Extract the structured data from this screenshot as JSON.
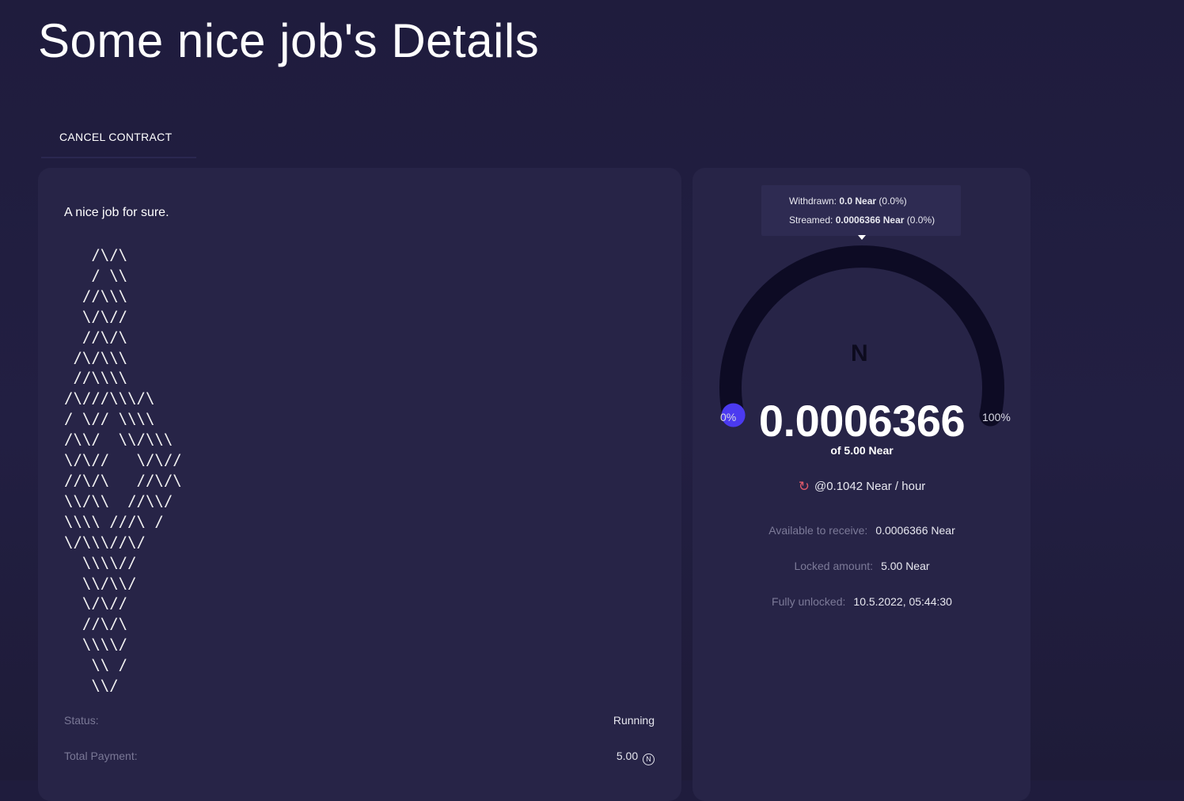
{
  "page": {
    "title": "Some nice job's Details"
  },
  "actions": {
    "cancel_label": "CANCEL CONTRACT"
  },
  "job": {
    "description": "A nice job for sure.",
    "ascii_art": "   /\\/\\\n   / \\\\\n  //\\\\\\\n  \\/\\//\n  //\\/\\\n /\\/\\\\\\\n //\\\\\\\\\n/\\///\\\\\\/\\\n/ \\// \\\\\\\\\n/\\\\/  \\\\/\\\\\\\n\\/\\//   \\/\\//\n//\\/\\   //\\/\\\n\\\\/\\\\  //\\\\/\n\\\\\\\\ ///\\ /\n\\/\\\\\\//\\/\n  \\\\\\\\//\n  \\\\/\\\\/\n  \\/\\//\n  //\\/\\\n  \\\\\\\\/\n   \\\\ /\n   \\\\/",
    "status_label": "Status:",
    "status_value": "Running",
    "payment_label": "Total Payment:",
    "payment_value": "5.00",
    "payment_icon": "near-circle-icon"
  },
  "stream": {
    "tooltip": {
      "withdrawn_label": "Withdrawn:",
      "withdrawn_amount": "0.0 Near",
      "withdrawn_pct": "(0.0%)",
      "streamed_label": "Streamed:",
      "streamed_amount": "0.0006366 Near",
      "streamed_pct": "(0.0%)"
    },
    "gauge": {
      "min_label": "0%",
      "max_label": "100%",
      "progress_fraction": 0.0,
      "track_color": "#0d0b24",
      "indicator_color": "#4b3af0"
    },
    "logo_text": "N",
    "streamed_value": "0.0006366",
    "of_total": "of 5.00 Near",
    "rate": "@0.1042 Near / hour",
    "rate_icon": "rotate-icon",
    "available_label": "Available to receive:",
    "available_value": "0.0006366 Near",
    "locked_label": "Locked amount:",
    "locked_value": "5.00 Near",
    "unlocked_label": "Fully unlocked:",
    "unlocked_value": "10.5.2022, 05:44:30"
  }
}
